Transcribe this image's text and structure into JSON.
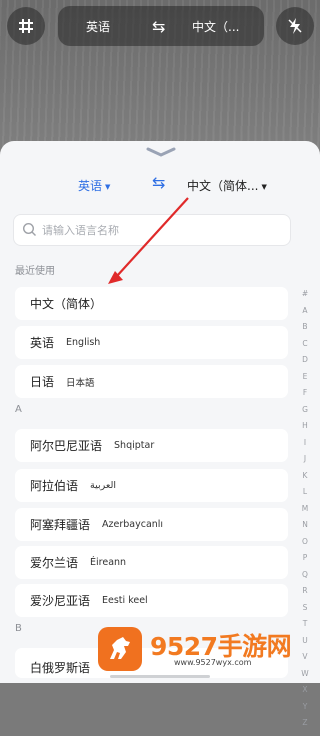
{
  "camera_bar": {
    "source_lang": "英语",
    "target_lang": "中文（...",
    "swap_icon": "swap-arrows-icon",
    "left_icon": "grid-icon",
    "right_icon": "flash-off-icon"
  },
  "picker": {
    "source_lang": "英语",
    "target_lang": "中文（简体...",
    "search_placeholder": "请输入语言名称",
    "recent_title": "最近使用",
    "recent": [
      {
        "cn": "中文（简体）",
        "native": ""
      },
      {
        "cn": "英语",
        "native": "English"
      },
      {
        "cn": "日语",
        "native": "日本語"
      }
    ],
    "section_a": "A",
    "a_items": [
      {
        "cn": "阿尔巴尼亚语",
        "native": "Shqiptar"
      },
      {
        "cn": "阿拉伯语",
        "native": "العربية"
      },
      {
        "cn": "阿塞拜疆语",
        "native": "Azerbaycanlı"
      },
      {
        "cn": "爱尔兰语",
        "native": "Éireann"
      },
      {
        "cn": "爱沙尼亚语",
        "native": "Eesti keel"
      }
    ],
    "section_b": "B",
    "b_partial": "白俄罗斯语",
    "alphabet": [
      "#",
      "A",
      "B",
      "C",
      "D",
      "E",
      "F",
      "G",
      "H",
      "I",
      "J",
      "K",
      "L",
      "M",
      "N",
      "O",
      "P",
      "Q",
      "R",
      "S",
      "T",
      "U",
      "V",
      "W",
      "X",
      "Y",
      "Z"
    ]
  },
  "watermark": {
    "title": "9527手游网",
    "url": "www.9527wyx.com"
  },
  "colors": {
    "accent": "#2f6fe4",
    "arrow": "#e02a2a",
    "watermark_orange": "#f27a21"
  }
}
